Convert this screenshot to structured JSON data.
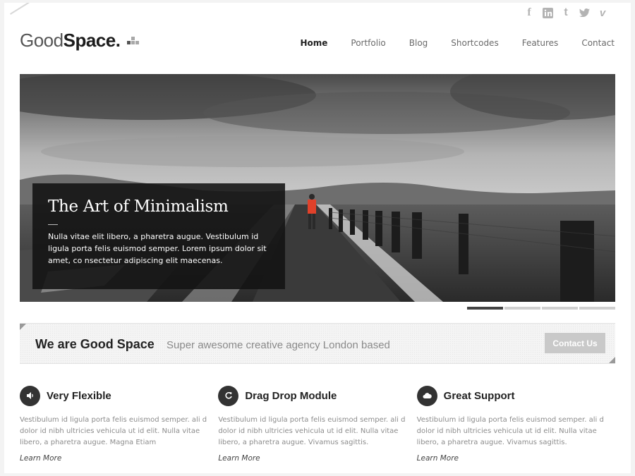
{
  "brand": {
    "logo_light": "Good",
    "logo_bold": "Space."
  },
  "social": [
    {
      "icon": "facebook-icon",
      "glyph": "f"
    },
    {
      "icon": "linkedin-icon",
      "glyph": "in"
    },
    {
      "icon": "tumblr-icon",
      "glyph": "t"
    },
    {
      "icon": "twitter-icon",
      "glyph": ""
    },
    {
      "icon": "vimeo-icon",
      "glyph": "v"
    }
  ],
  "nav": {
    "items": [
      {
        "label": "Home",
        "active": true
      },
      {
        "label": "Portfolio",
        "active": false
      },
      {
        "label": "Blog",
        "active": false
      },
      {
        "label": "Shortcodes",
        "active": false
      },
      {
        "label": "Features",
        "active": false
      },
      {
        "label": "Contact",
        "active": false
      }
    ]
  },
  "hero": {
    "title": "The Art of Minimalism",
    "text": "Nulla vitae elit libero, a pharetra augue. Vestibulum id ligula porta felis euismod semper. Lorem ipsum dolor sit amet, co nsectetur adipiscing elit maecenas.",
    "slides_total": 4,
    "active_slide": 1
  },
  "banner": {
    "heading": "We are Good Space",
    "tagline": "Super awesome creative agency London based",
    "button": "Contact Us"
  },
  "features": [
    {
      "icon": "speaker-icon",
      "title": "Very Flexible",
      "text": "Vestibulum id ligula porta felis euismod semper. ali d dolor id nibh ultricies vehicula ut id elit. Nulla vitae libero, a pharetra augue. Magna Etiam",
      "link": "Learn More"
    },
    {
      "icon": "refresh-icon",
      "title": "Drag Drop Module",
      "text": "Vestibulum id ligula porta felis euismod semper. ali d dolor id nibh ultricies vehicula ut id elit. Nulla vitae libero, a pharetra augue. Vivamus sagittis.",
      "link": "Learn More"
    },
    {
      "icon": "cloud-icon",
      "title": "Great Support",
      "text": "Vestibulum id ligula porta felis euismod semper. ali d dolor id nibh ultricies vehicula ut id elit. Nulla vitae libero, a pharetra augue. Vivamus sagittis.",
      "link": "Learn More"
    }
  ],
  "colors": {
    "accent_runner": "#e0412a",
    "dark": "#333333",
    "muted_text": "#8c8c8c"
  }
}
